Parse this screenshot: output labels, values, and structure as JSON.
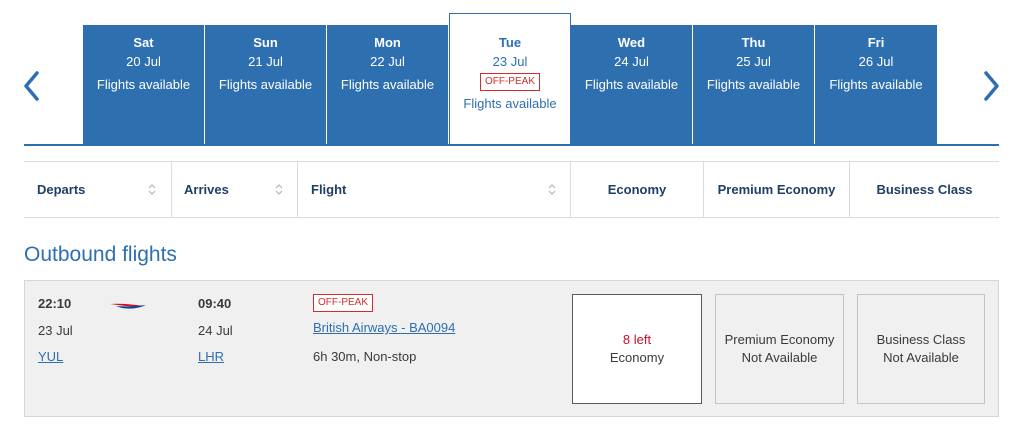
{
  "carousel": {
    "days": [
      {
        "name": "Sat",
        "date": "20 Jul",
        "status": "Flights available"
      },
      {
        "name": "Sun",
        "date": "21 Jul",
        "status": "Flights available"
      },
      {
        "name": "Mon",
        "date": "22 Jul",
        "status": "Flights available"
      },
      {
        "name": "Tue",
        "date": "23 Jul",
        "badge": "OFF-PEAK",
        "status": "Flights available"
      },
      {
        "name": "Wed",
        "date": "24 Jul",
        "status": "Flights available"
      },
      {
        "name": "Thu",
        "date": "25 Jul",
        "status": "Flights available"
      },
      {
        "name": "Fri",
        "date": "26 Jul",
        "status": "Flights available"
      }
    ],
    "prev_icon": "chevron-left-icon",
    "next_icon": "chevron-right-icon"
  },
  "columns": {
    "departs": "Departs",
    "arrives": "Arrives",
    "flight": "Flight",
    "economy": "Economy",
    "premium_economy": "Premium Economy",
    "business": "Business Class"
  },
  "section_title": "Outbound flights",
  "flight": {
    "depart_time": "22:10",
    "depart_date": "23 Jul",
    "depart_airport": "YUL",
    "arrive_time": "09:40",
    "arrive_date": "24 Jul",
    "arrive_airport": "LHR",
    "badge": "OFF-PEAK",
    "flight_name": "British Airways - BA0094",
    "duration": "6h 30m, Non-stop",
    "logo_icon": "british-airways-logo",
    "fares": {
      "economy": {
        "seats": "8 left",
        "label": "Economy"
      },
      "premium_economy": {
        "label": "Premium Economy",
        "status": "Not Available"
      },
      "business": {
        "label": "Business Class",
        "status": "Not Available"
      }
    }
  },
  "colors": {
    "brand_blue": "#2e6fb0",
    "header_text": "#1f3f66",
    "offpeak_red": "#d42c2c",
    "seats_red": "#c8102e"
  }
}
